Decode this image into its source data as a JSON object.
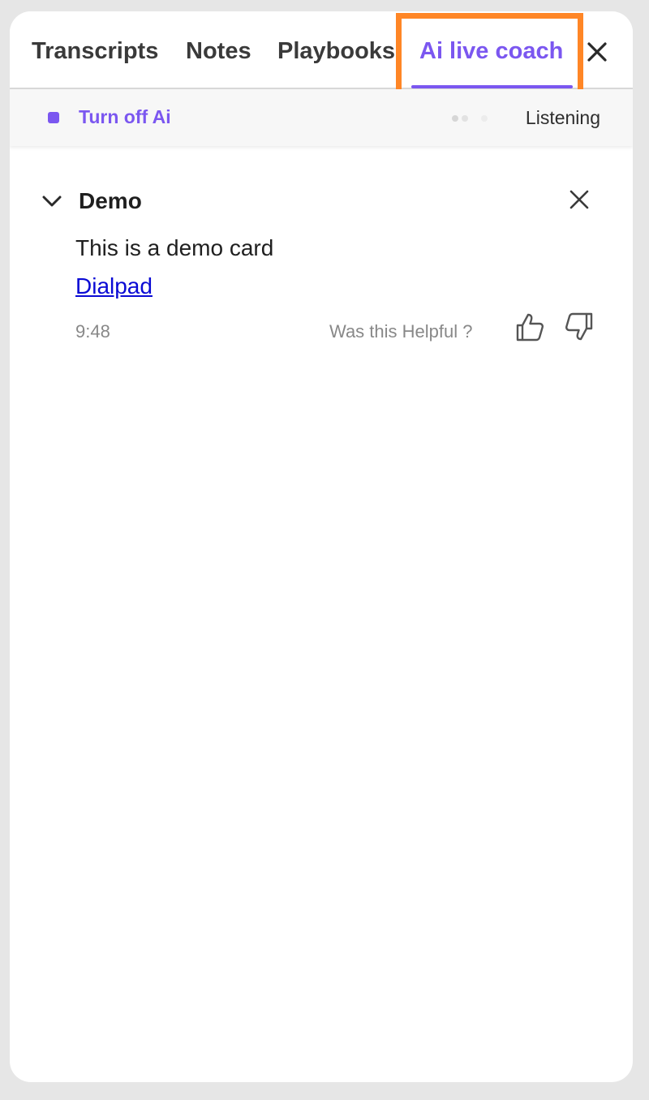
{
  "tabs": [
    {
      "label": "Transcripts",
      "active": false
    },
    {
      "label": "Notes",
      "active": false
    },
    {
      "label": "Playbooks",
      "active": false
    },
    {
      "label": "Ai live coach",
      "active": true
    }
  ],
  "status": {
    "turn_off_label": "Turn off Ai",
    "state_label": "Listening"
  },
  "card": {
    "title": "Demo",
    "body": "This is a demo card",
    "link_text": "Dialpad",
    "time": "9:48",
    "feedback_prompt": "Was this Helpful ?"
  },
  "icons": {
    "close_tabs": "close-icon",
    "chevron": "chevron-down-icon",
    "card_close": "close-icon",
    "thumbs_up": "thumbs-up-icon",
    "thumbs_down": "thumbs-down-icon"
  },
  "colors": {
    "accent": "#7b57f0",
    "highlight": "#ff8626",
    "link": "#0a0ad4",
    "muted": "#888888"
  }
}
